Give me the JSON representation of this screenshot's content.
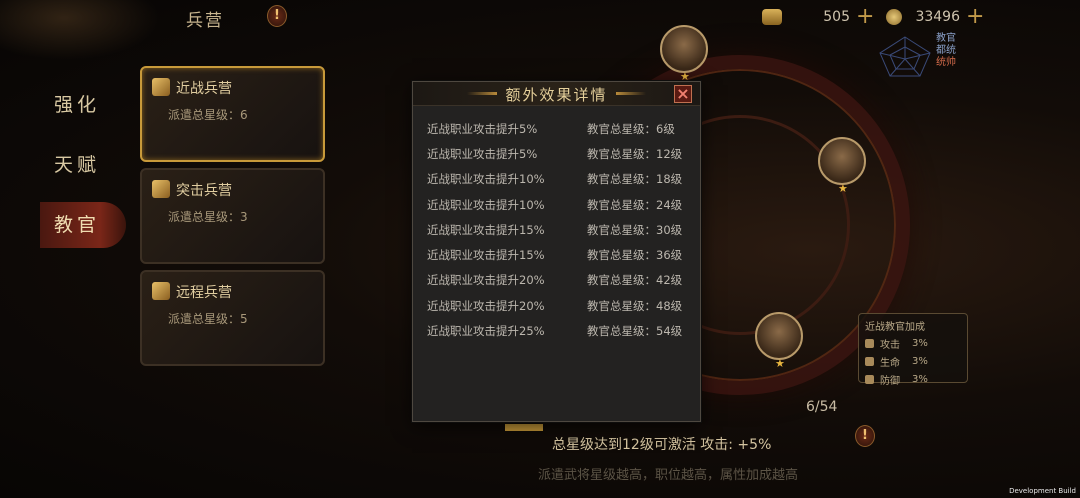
{
  "topbar": {
    "title": "兵营",
    "warn_glyph": "!",
    "resource1_value": "505",
    "resource2_value": "33496",
    "plus_glyph": "+"
  },
  "nav": {
    "items": [
      {
        "label": "强化"
      },
      {
        "label": "天赋"
      },
      {
        "label": "教官"
      }
    ]
  },
  "cards": [
    {
      "title": "近战兵营",
      "sub": "派遣总星级：6"
    },
    {
      "title": "突击兵营",
      "sub": "派遣总星级：3"
    },
    {
      "title": "远程兵营",
      "sub": "派遣总星级：5"
    }
  ],
  "radar_legend": [
    "教官",
    "都统",
    "统帅"
  ],
  "bonus_panel": {
    "title": "近战教官加成",
    "rows": [
      {
        "label": "攻击",
        "value": "3%"
      },
      {
        "label": "生命",
        "value": "3%"
      },
      {
        "label": "防御",
        "value": "3%"
      }
    ]
  },
  "progress_text": "6/54",
  "footer": {
    "line": "总星级达到12级可激活  攻击: +5%",
    "hint": "派遣武将星级越高，职位越高，属性加成越高"
  },
  "dev_build": "Development Build",
  "modal": {
    "title": "额外效果详情",
    "close_glyph": "×",
    "effects": [
      {
        "effect": "近战职业攻击提升5%",
        "req": "教官总星级：6级"
      },
      {
        "effect": "近战职业攻击提升5%",
        "req": "教官总星级：12级"
      },
      {
        "effect": "近战职业攻击提升10%",
        "req": "教官总星级：18级"
      },
      {
        "effect": "近战职业攻击提升10%",
        "req": "教官总星级：24级"
      },
      {
        "effect": "近战职业攻击提升15%",
        "req": "教官总星级：30级"
      },
      {
        "effect": "近战职业攻击提升15%",
        "req": "教官总星级：36级"
      },
      {
        "effect": "近战职业攻击提升20%",
        "req": "教官总星级：42级"
      },
      {
        "effect": "近战职业攻击提升20%",
        "req": "教官总星级：48级"
      },
      {
        "effect": "近战职业攻击提升25%",
        "req": "教官总星级：54级"
      }
    ]
  },
  "colors": {
    "accent_gold": "#c89a3a",
    "modal_bg": "#232221",
    "close_red": "#5a1a12"
  }
}
